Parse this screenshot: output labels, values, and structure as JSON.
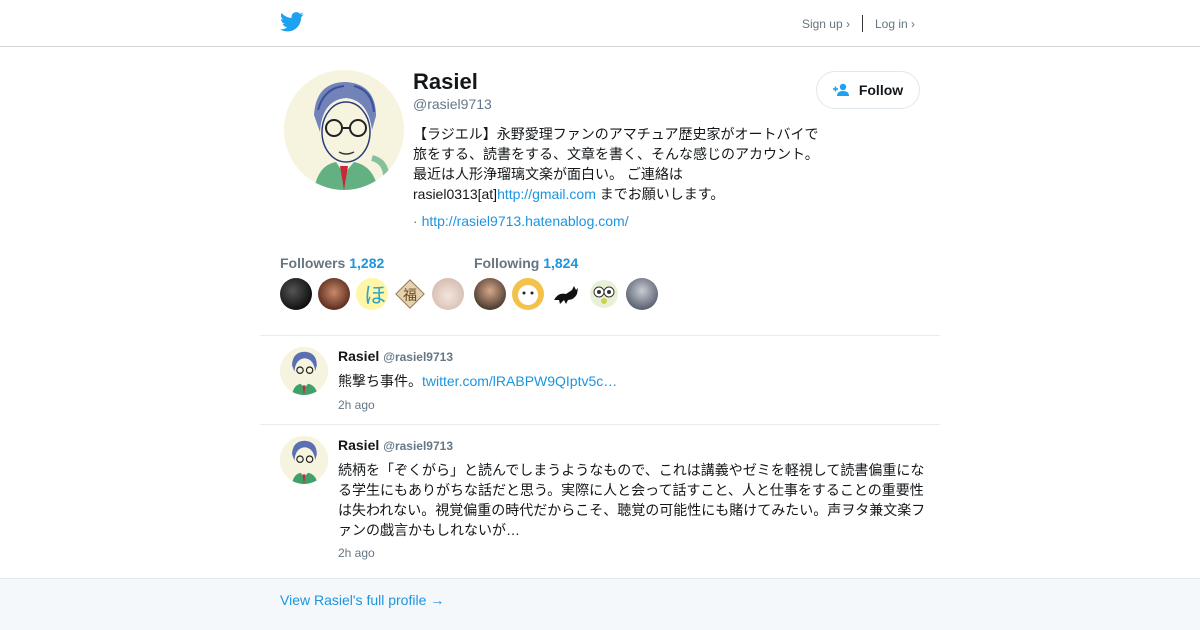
{
  "header": {
    "logo_icon": "twitter-bird-icon",
    "brand_color": "#1da1f2",
    "signup_label": "Sign up ›",
    "login_label": "Log in ›"
  },
  "profile": {
    "name": "Rasiel",
    "handle": "@rasiel9713",
    "follow_label": "Follow",
    "bio_text": "【ラジエル】永野愛理ファンのアマチュア歴史家がオートバイで旅をする、読書をする、文章を書く、そんな感じのアカウント。最近は人形浄瑠璃文楽が面白い。 ご連絡は rasiel0313[at]",
    "bio_link": "http://gmail.com",
    "bio_tail": " までお願いします。",
    "url_prefix": "· ",
    "url": "http://rasiel9713.hatenablog.com/"
  },
  "stats": {
    "followers_label": "Followers",
    "followers_count": "1,282",
    "following_label": "Following",
    "following_count": "1,824"
  },
  "tweets": [
    {
      "name": "Rasiel",
      "handle": "@rasiel9713",
      "text": "熊撃ち事件。",
      "link": "twitter.com/lRABPW9QIptv5c…",
      "time": "2h ago"
    },
    {
      "name": "Rasiel",
      "handle": "@rasiel9713",
      "text": "続柄を「ぞくがら」と読んでしまうようなもので、これは講義やゼミを軽視して読書偏重になる学生にもありがちな話だと思う。実際に人と会って話すこと、人と仕事をすることの重要性は失われない。視覚偏重の時代だからこそ、聴覚の可能性にも賭けてみたい。声ヲタ兼文楽ファンの戯言かもしれないが…",
      "time": "2h ago"
    }
  ],
  "footer": {
    "full_profile_label": "View Rasiel's full profile →"
  }
}
